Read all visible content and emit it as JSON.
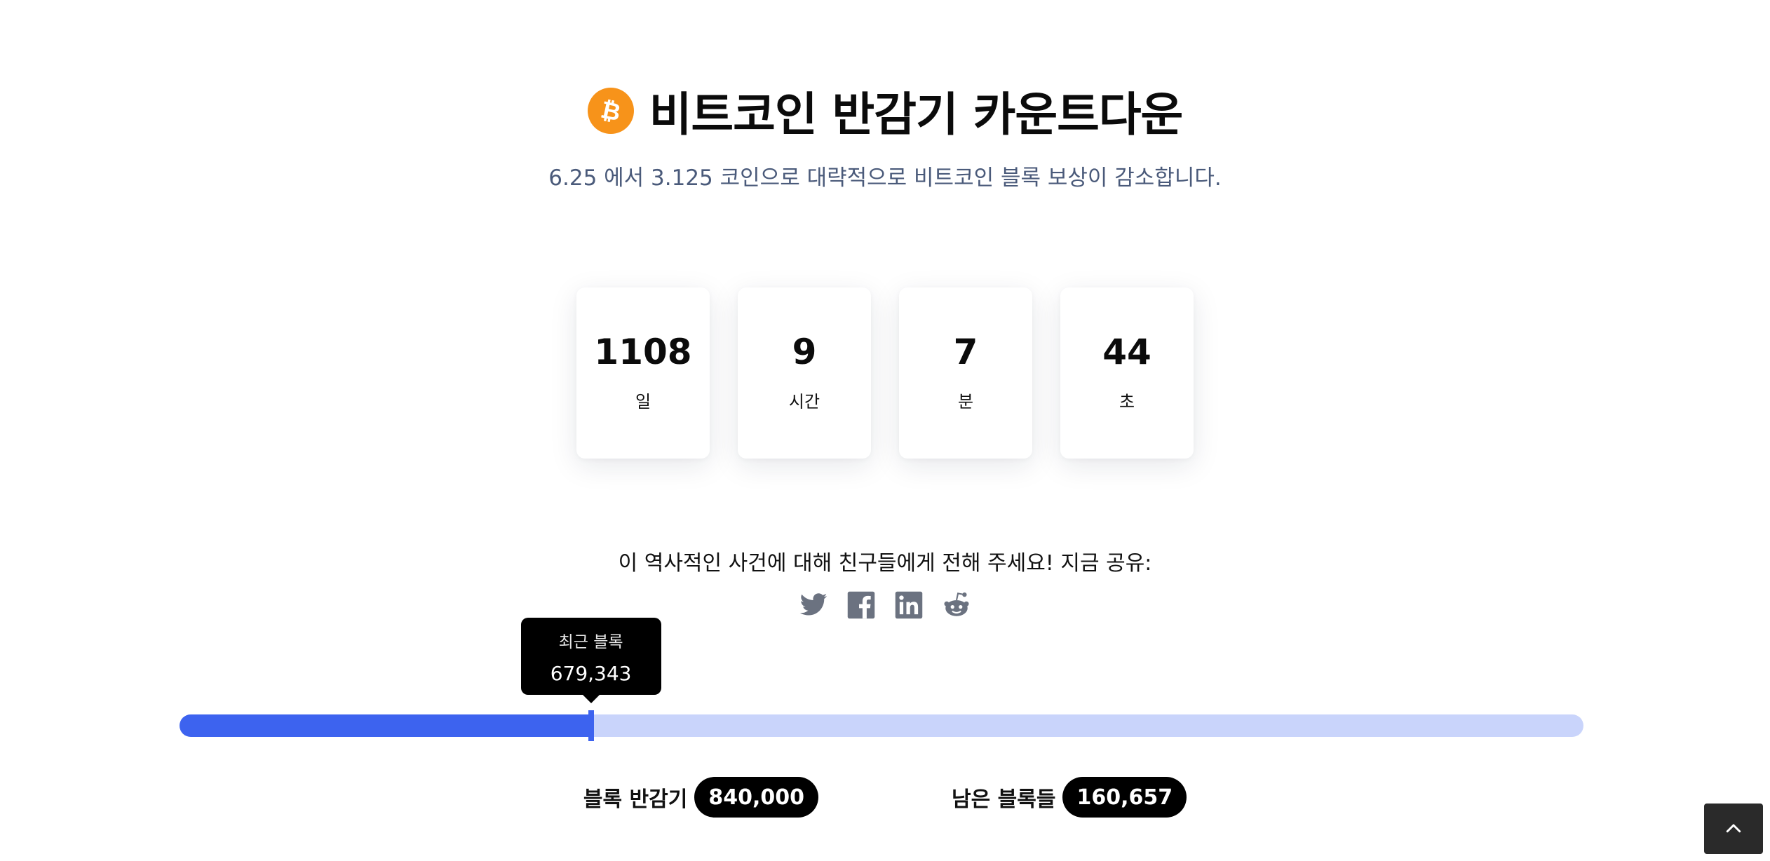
{
  "header": {
    "title": "비트코인 반감기 카운트다운",
    "subtitle": "6.25 에서 3.125 코인으로 대략적으로 비트코인 블록 보상이 감소합니다.",
    "logo_icon": "bitcoin-icon",
    "logo_color": "#f7931a"
  },
  "countdown": {
    "days": {
      "value": "1108",
      "unit": "일"
    },
    "hours": {
      "value": "9",
      "unit": "시간"
    },
    "minutes": {
      "value": "7",
      "unit": "분"
    },
    "seconds": {
      "value": "44",
      "unit": "초"
    }
  },
  "share": {
    "text": "이 역사적인 사건에 대해 친구들에게 전해 주세요! 지금 공유:",
    "icons": [
      "twitter-icon",
      "facebook-icon",
      "linkedin-icon",
      "reddit-icon"
    ],
    "icon_color": "#6b7280"
  },
  "progress": {
    "tooltip_label": "최근 블록",
    "tooltip_value": "679,343",
    "current_block": 679343,
    "halving_block": 840000,
    "fill_color": "#3d63ef",
    "track_color": "#c9d4fb"
  },
  "stats": {
    "halving_label": "블록 반감기",
    "halving_value": "840,000",
    "remaining_label": "남은 블록들",
    "remaining_value": "160,657"
  },
  "back_to_top": {
    "icon": "chevron-up-icon"
  }
}
